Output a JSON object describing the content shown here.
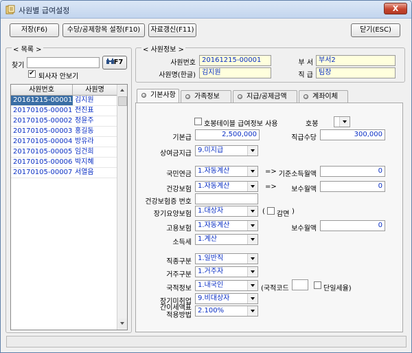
{
  "window": {
    "title": "사원별 급여설정",
    "close_label": "X"
  },
  "toolbar": {
    "save": "저장(F6)",
    "allowance": "수당/공제항목 설정(F10)",
    "refresh": "자료갱신(F11)",
    "close": "닫기(ESC)"
  },
  "list": {
    "group_title": "목록",
    "search_label": "찾기",
    "search_value": "",
    "search_button": "F7",
    "hide_retired_label": "퇴사자 안보기",
    "hide_retired_checked": true,
    "columns": [
      "사원번호",
      "사원명"
    ],
    "rows": [
      [
        "20161215-00001",
        "김지원"
      ],
      [
        "20170105-00001",
        "전진표"
      ],
      [
        "20170105-00002",
        "정윤주"
      ],
      [
        "20170105-00003",
        "홍길동"
      ],
      [
        "20170105-00004",
        "방유라"
      ],
      [
        "20170105-00005",
        "임건희"
      ],
      [
        "20170105-00006",
        "박지혜"
      ],
      [
        "20170105-00007",
        "서열음"
      ]
    ],
    "selected_index": 0
  },
  "employee": {
    "group_title": "사원정보",
    "id_label": "사원번호",
    "id_value": "20161215-00001",
    "dept_label": "부 서",
    "dept_value": "부서2",
    "name_label": "사원명(한글)",
    "name_value": "김지원",
    "rank_label": "직 급",
    "rank_value": "팀장"
  },
  "tabs": [
    "기본사항",
    "가족정보",
    "지급/공제금액",
    "계좌이체"
  ],
  "basic": {
    "use_grade_table_label": "호봉테이블 급여정보 사용",
    "grade_label": "호봉",
    "grade_value": "",
    "base_pay_label": "기본급",
    "base_pay_value": "2,500,000",
    "rank_allowance_label": "직급수당",
    "rank_allowance_value": "300,000",
    "bonus_label": "상여금지급",
    "bonus_value": "9.미지급",
    "pension_label": "국민연금",
    "pension_value": "1.자동계산",
    "pension_arrow": "=>",
    "base_income_label": "기준소득월액",
    "base_income_value": "0",
    "health_label": "건강보험",
    "health_value": "1.자동계산",
    "health_arrow": "=>",
    "health_monthly_label": "보수월액",
    "health_monthly_value": "0",
    "health_card_label": "건강보험증 번호",
    "health_card_value": "",
    "longterm_label": "장기요양보험",
    "longterm_value": "1.대상자",
    "reduction_open": "(",
    "reduction_label": "감면",
    "reduction_close": ")",
    "employ_label": "고용보험",
    "employ_value": "1.자동계산",
    "employ_monthly_label": "보수월액",
    "employ_monthly_value": "0",
    "income_tax_label": "소득세",
    "income_tax_value": "1.계산",
    "job_type_label": "직종구분",
    "job_type_value": "1.일반직",
    "residence_label": "거주구분",
    "residence_value": "1.거주자",
    "nationality_label": "국적정보",
    "nationality_value": "1.내국인",
    "country_code_open": "(국적코드",
    "country_code_value": "",
    "single_tax_label": "단일세율)",
    "disabled_label": "장기미취업",
    "disabled_value": "9.비대상자",
    "simple_tax_label_1": "간이세액표",
    "simple_tax_label_2": "적용방법",
    "simple_tax_value": "2.100%"
  }
}
